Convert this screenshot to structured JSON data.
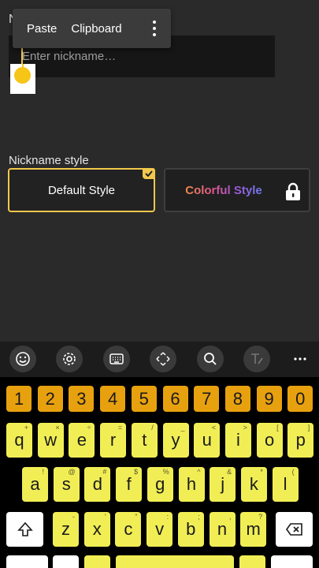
{
  "nickname": {
    "label": "N",
    "placeholder": "Enter nickname…"
  },
  "context_menu": {
    "paste": "Paste",
    "clipboard": "Clipboard",
    "more_icon": "more-vertical-icon"
  },
  "style": {
    "label": "Nickname style",
    "default_label": "Default Style",
    "colorful_label": "Colorful Style",
    "selected": "Default Style",
    "accent": "#f2c94c"
  },
  "keyboard": {
    "toolbar_icons": [
      "emoji-icon",
      "settings-icon",
      "keyboard-icon",
      "move-icon",
      "search-icon",
      "handwriting-icon",
      "more-horizontal-icon"
    ],
    "number_row": [
      "1",
      "2",
      "3",
      "4",
      "5",
      "6",
      "7",
      "8",
      "9",
      "0"
    ],
    "row1": [
      {
        "key": "q",
        "hint": "+"
      },
      {
        "key": "w",
        "hint": "×"
      },
      {
        "key": "e",
        "hint": "÷"
      },
      {
        "key": "r",
        "hint": "="
      },
      {
        "key": "t",
        "hint": "/"
      },
      {
        "key": "y",
        "hint": "_"
      },
      {
        "key": "u",
        "hint": "<"
      },
      {
        "key": "i",
        "hint": ">"
      },
      {
        "key": "o",
        "hint": "["
      },
      {
        "key": "p",
        "hint": "]"
      }
    ],
    "row2": [
      {
        "key": "a",
        "hint": "!"
      },
      {
        "key": "s",
        "hint": "@"
      },
      {
        "key": "d",
        "hint": "#"
      },
      {
        "key": "f",
        "hint": "$"
      },
      {
        "key": "g",
        "hint": "%"
      },
      {
        "key": "h",
        "hint": "^"
      },
      {
        "key": "j",
        "hint": "&"
      },
      {
        "key": "k",
        "hint": "*"
      },
      {
        "key": "l",
        "hint": "("
      }
    ],
    "row3": [
      {
        "key": "z",
        "hint": "-"
      },
      {
        "key": "x",
        "hint": "'"
      },
      {
        "key": "c",
        "hint": "\""
      },
      {
        "key": "v",
        "hint": ":"
      },
      {
        "key": "b",
        "hint": ";"
      },
      {
        "key": "n",
        "hint": ","
      },
      {
        "key": "m",
        "hint": "?"
      }
    ],
    "colors": {
      "number": "#e8a10e",
      "letter": "#f1ee55"
    }
  }
}
